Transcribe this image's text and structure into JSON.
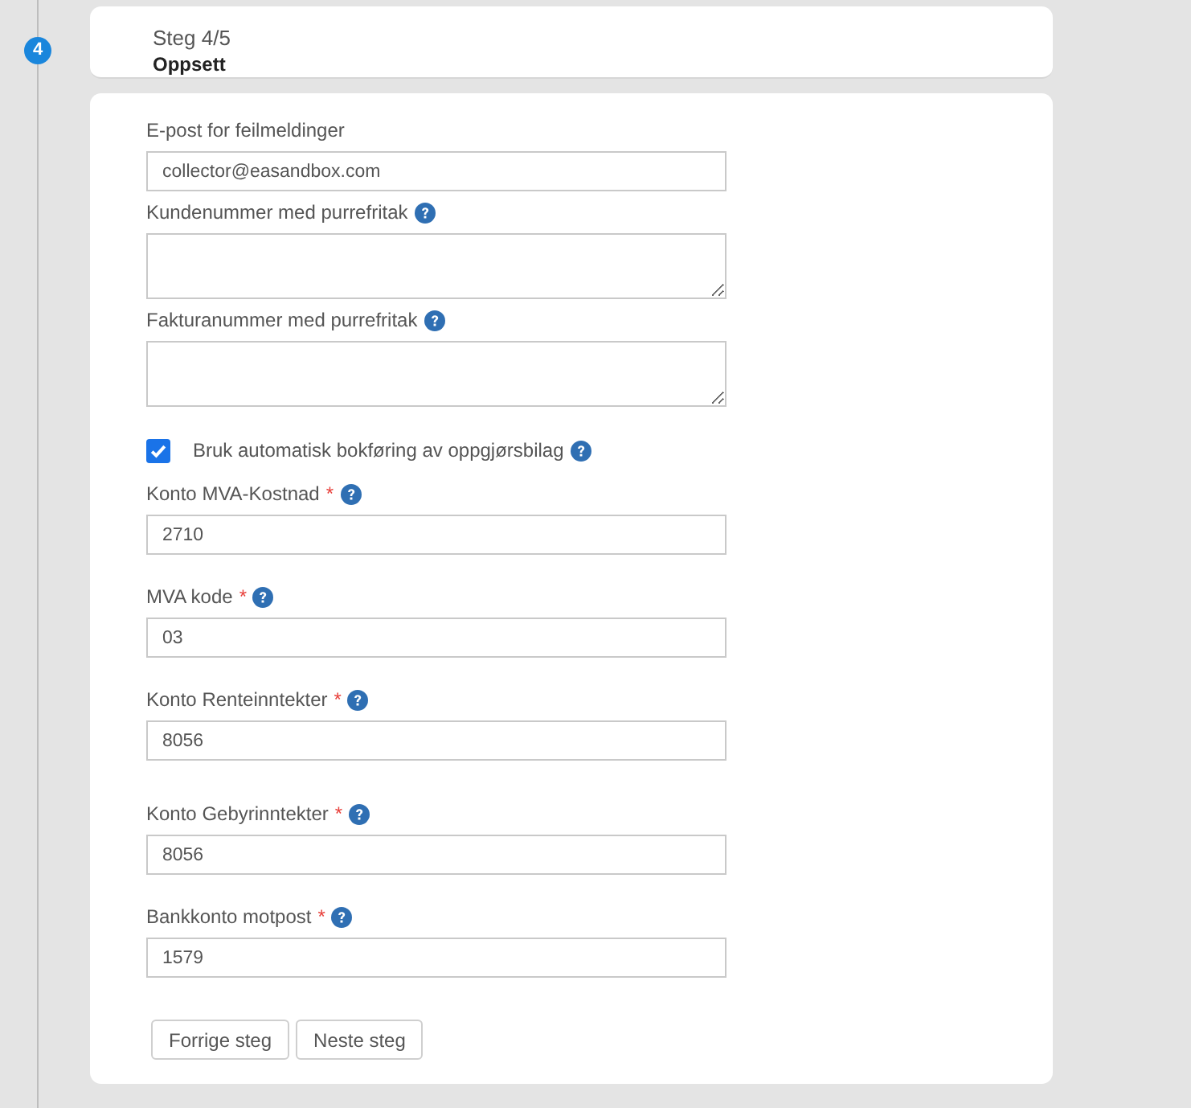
{
  "stepper": {
    "number": "4"
  },
  "header": {
    "step": "Steg 4/5",
    "title": "Oppsett"
  },
  "form": {
    "fields": [
      {
        "kind": "input",
        "label": "E-post for feilmeldinger",
        "value": "collector@easandbox.com",
        "help": false
      },
      {
        "kind": "textarea",
        "label": "Kundenummer med purrefritak",
        "help": true
      },
      {
        "kind": "textarea",
        "label": "Fakturanummer med purrefritak",
        "help": true
      }
    ],
    "auto_posting": {
      "label": "Bruk automatisk bokføring av oppgjørsbilag",
      "checked": true,
      "help": true
    },
    "accounts": [
      {
        "label": "Konto MVA-Kostnad",
        "required_mark": "*",
        "value": "2710",
        "help": true
      },
      {
        "label": "MVA kode",
        "required_mark": "*",
        "value": "03",
        "help": true
      },
      {
        "label": "Konto Renteinntekter",
        "required_mark": "*",
        "value": "8056",
        "help": true
      },
      {
        "label": "Konto Gebyrinntekter",
        "required_mark": "*",
        "value": "8056",
        "help": true
      },
      {
        "label": "Bankkonto motpost",
        "required_mark": "*",
        "value": "1579",
        "help": true
      }
    ]
  },
  "buttons": [
    {
      "label": "Forrige steg"
    },
    {
      "label": "Neste steg"
    }
  ]
}
